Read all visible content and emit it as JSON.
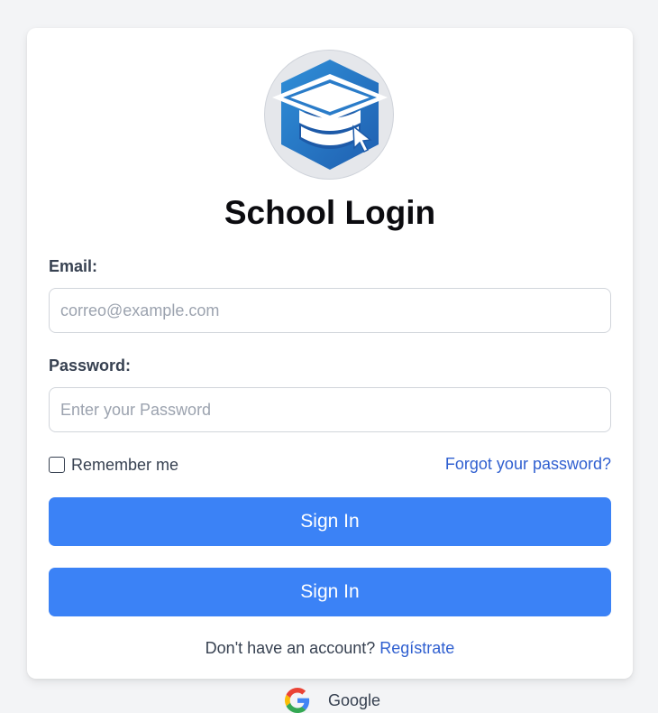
{
  "login": {
    "title": "School Login",
    "email_label": "Email:",
    "email_placeholder": "correo@example.com",
    "password_label": "Password:",
    "password_placeholder": "Enter your Password",
    "remember_label": "Remember me",
    "forgot_link": "Forgot your password?",
    "signin_button_1": "Sign In",
    "signin_button_2": "Sign In",
    "signup_prompt": "Don't have an account?",
    "signup_link": "Regístrate",
    "google_label": "Google"
  },
  "icons": {
    "logo": "graduation-cap-cursor-logo",
    "google": "google-g-icon",
    "checkbox": "checkbox"
  },
  "colors": {
    "primary_button": "#3b82f6",
    "link": "#2f5fd0",
    "background": "#f3f4f6",
    "card": "#ffffff"
  }
}
